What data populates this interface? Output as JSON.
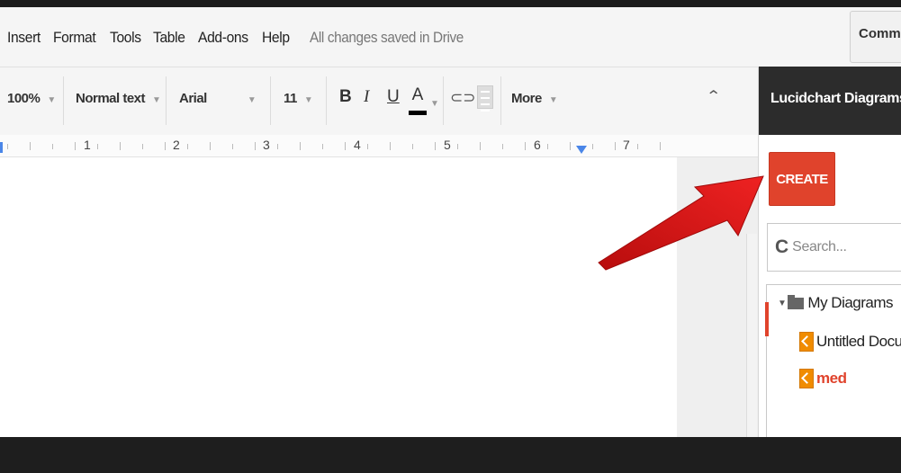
{
  "menu": {
    "items": [
      "Insert",
      "Format",
      "Tools",
      "Table",
      "Add-ons",
      "Help"
    ],
    "save_status": "All changes saved in Drive",
    "comments_label": "Commen"
  },
  "toolbar": {
    "zoom": "100%",
    "style": "Normal text",
    "font": "Arial",
    "font_size": "11",
    "bold": "B",
    "italic": "I",
    "underline": "U",
    "text_color": "A",
    "more_label": "More"
  },
  "ruler": {
    "numbers": [
      "1",
      "2",
      "3",
      "4",
      "5",
      "6",
      "7"
    ]
  },
  "panel": {
    "title": "Lucidchart Diagrams",
    "create_label": "CREATE",
    "search_placeholder": "Search...",
    "tree": {
      "folder": "My Diagrams",
      "items": [
        "Untitled Docum",
        "med"
      ]
    }
  },
  "colors": {
    "create_button": "#e0432c",
    "panel_header": "#2c2c2c",
    "annotation_arrow": "#e01818",
    "ruler_marker": "#4a86e8"
  },
  "icons": [
    "link-icon",
    "comment-icon",
    "collapse-toolbar-icon",
    "refresh-icon",
    "folder-icon",
    "lucidchart-doc-icon",
    "red-annotation-arrow"
  ]
}
